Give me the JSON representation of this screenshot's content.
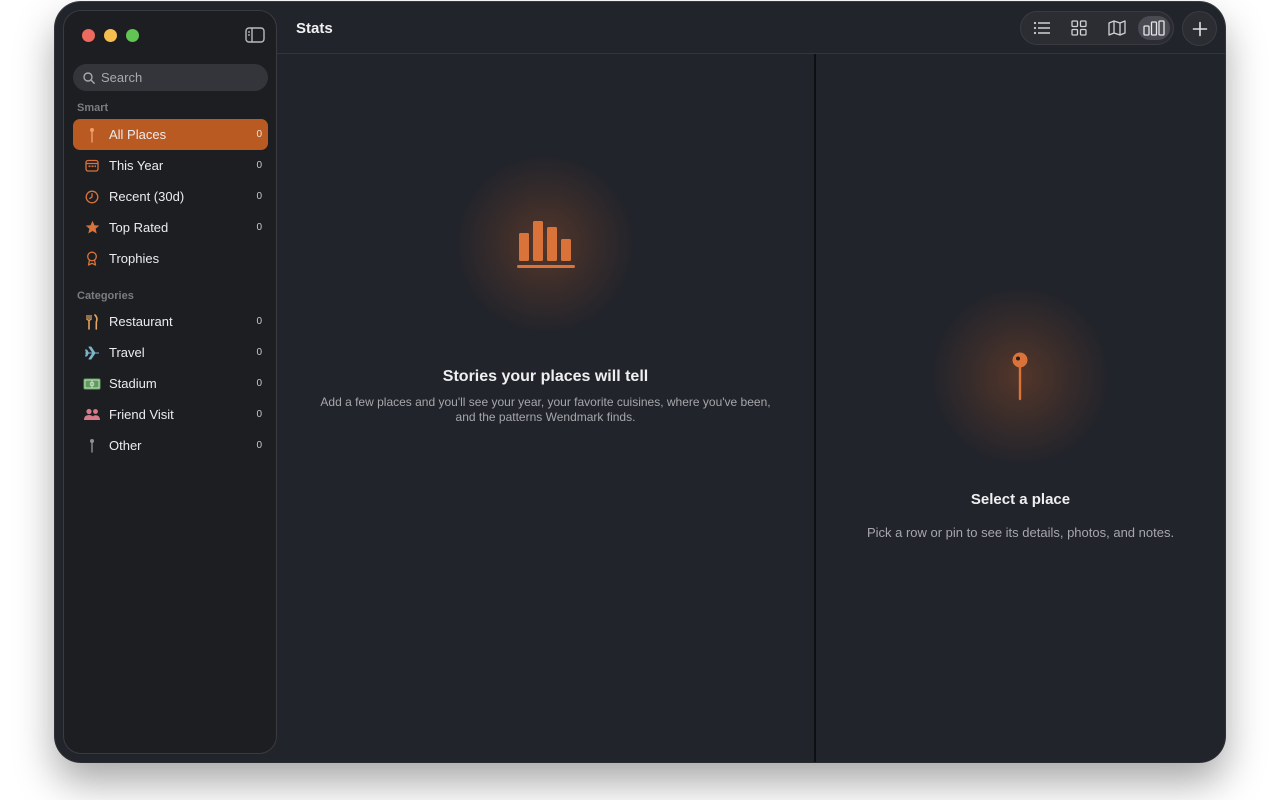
{
  "toolbar": {
    "title": "Stats"
  },
  "search": {
    "placeholder": "Search"
  },
  "sidebar": {
    "smart_heading": "Smart",
    "categories_heading": "Categories",
    "smart_items": [
      {
        "label": "All Places",
        "count": "0",
        "icon": "pin-icon"
      },
      {
        "label": "This Year",
        "count": "0",
        "icon": "calendar-icon"
      },
      {
        "label": "Recent (30d)",
        "count": "0",
        "icon": "clock-icon"
      },
      {
        "label": "Top Rated",
        "count": "0",
        "icon": "star-icon"
      },
      {
        "label": "Trophies",
        "count": "",
        "icon": "trophy-icon"
      }
    ],
    "category_items": [
      {
        "label": "Restaurant",
        "count": "0",
        "icon": "fork-knife-icon"
      },
      {
        "label": "Travel",
        "count": "0",
        "icon": "airplane-icon"
      },
      {
        "label": "Stadium",
        "count": "0",
        "icon": "stadium-icon"
      },
      {
        "label": "Friend Visit",
        "count": "0",
        "icon": "people-icon"
      },
      {
        "label": "Other",
        "count": "0",
        "icon": "pin-icon"
      }
    ]
  },
  "stats_empty": {
    "title": "Stories your places will tell",
    "body_line1": "Add a few places and you'll see your year, your favorite cuisines, where you've been,",
    "body_line2": "and the patterns Wendmark finds."
  },
  "detail_empty": {
    "title": "Select a place",
    "body": "Pick a row or pin to see its details, photos, and notes."
  },
  "colors": {
    "accent": "#b85a22",
    "icon_orange": "#d9733a",
    "window_bg": "#22242b",
    "sidebar_bg": "#1d1e22"
  }
}
